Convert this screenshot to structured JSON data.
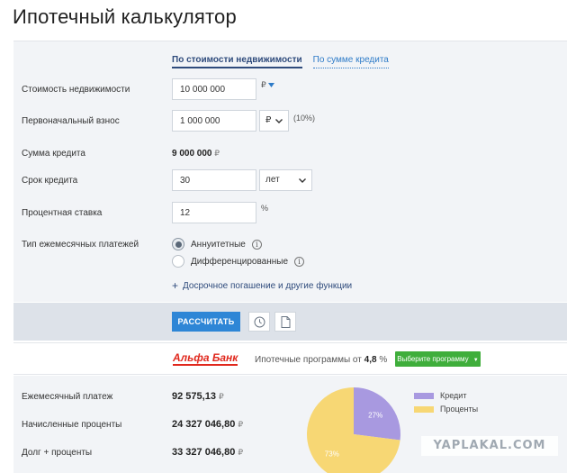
{
  "page": {
    "title": "Ипотечный калькулятор"
  },
  "tabs": [
    {
      "label": "По стоимости недвижимости",
      "active": true
    },
    {
      "label": "По сумме кредита",
      "active": false
    }
  ],
  "form": {
    "property_cost": {
      "label": "Стоимость недвижимости",
      "value": "10 000 000",
      "currency": "₽"
    },
    "down_payment": {
      "label": "Первоначальный взнос",
      "value": "1 000 000",
      "currency": "₽",
      "percent": "(10%)"
    },
    "loan_amount": {
      "label": "Сумма кредита",
      "value": "9 000 000",
      "currency": "₽"
    },
    "term": {
      "label": "Срок кредита",
      "value": "30",
      "unit": "лет"
    },
    "rate": {
      "label": "Процентная ставка",
      "value": "12",
      "unit": "%"
    },
    "payment_type": {
      "label": "Тип ежемесячных платежей",
      "options": [
        {
          "label": "Аннуитетные",
          "checked": true
        },
        {
          "label": "Дифференцированные",
          "checked": false
        }
      ]
    },
    "early_repayment_link": "Досрочное погашение и другие функции"
  },
  "actions": {
    "calculate_label": "РАССЧИТАТЬ"
  },
  "bank": {
    "name": "Альфа Банк",
    "programs_prefix": "Ипотечные программы от",
    "programs_rate": "4,8",
    "programs_unit": "%",
    "choose_label": "Выберите программу"
  },
  "results": {
    "monthly_payment": {
      "label": "Ежемесячный платеж",
      "value": "92 575,13",
      "currency": "₽"
    },
    "interest": {
      "label": "Начисленные проценты",
      "value": "24 327 046,80",
      "currency": "₽"
    },
    "total": {
      "label": "Долг + проценты",
      "value": "33 327 046,80",
      "currency": "₽"
    }
  },
  "chart_data": {
    "type": "pie",
    "series": [
      {
        "name": "Кредит",
        "value": 27,
        "label": "27%",
        "color": "#a899e0"
      },
      {
        "name": "Проценты",
        "value": 73,
        "label": "73%",
        "color": "#f7d774"
      }
    ]
  },
  "watermark": "YAPLAKAL.COM",
  "colors": {
    "accent": "#2e86d6",
    "green": "#3fae3b",
    "bank_red": "#e0281d"
  }
}
